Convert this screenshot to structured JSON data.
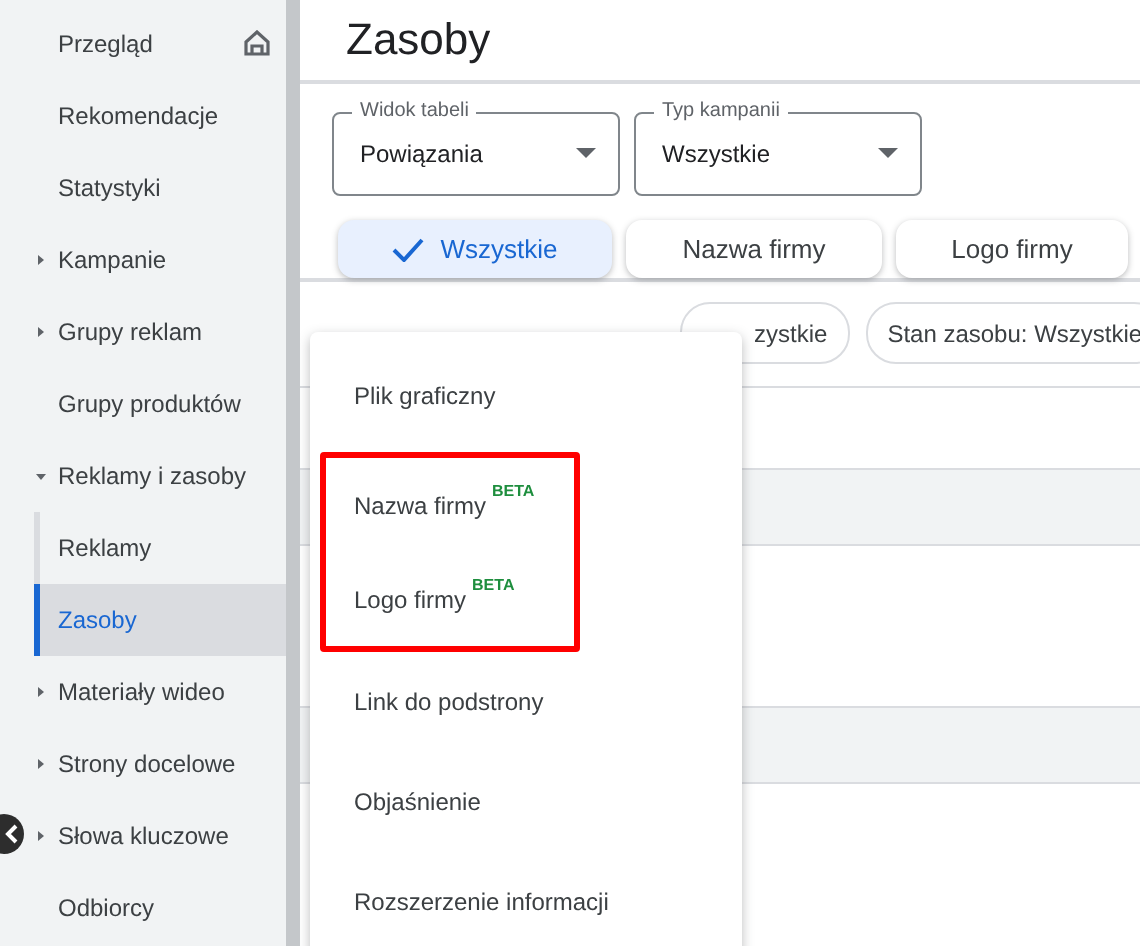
{
  "sidebar": {
    "items": [
      {
        "label": "Przegląd",
        "kind": "home",
        "selected": false
      },
      {
        "label": "Rekomendacje",
        "kind": "plain",
        "selected": false
      },
      {
        "label": "Statystyki",
        "kind": "plain",
        "selected": false
      },
      {
        "label": "Kampanie",
        "kind": "expander",
        "expanded": false,
        "selected": false
      },
      {
        "label": "Grupy reklam",
        "kind": "expander",
        "expanded": false,
        "selected": false
      },
      {
        "label": "Grupy produktów",
        "kind": "plain",
        "selected": false
      },
      {
        "label": "Reklamy i zasoby",
        "kind": "expander",
        "expanded": true,
        "selected": false,
        "children": [
          {
            "label": "Reklamy",
            "selected": false
          },
          {
            "label": "Zasoby",
            "selected": true
          }
        ]
      },
      {
        "label": "Materiały wideo",
        "kind": "expander",
        "expanded": false,
        "selected": false
      },
      {
        "label": "Strony docelowe",
        "kind": "expander",
        "expanded": false,
        "selected": false
      },
      {
        "label": "Słowa kluczowe",
        "kind": "expander",
        "expanded": false,
        "selected": false
      },
      {
        "label": "Odbiorcy",
        "kind": "plain",
        "selected": false
      }
    ]
  },
  "page": {
    "title": "Zasoby"
  },
  "filters": [
    {
      "label": "Widok tabeli",
      "value": "Powiązania"
    },
    {
      "label": "Typ kampanii",
      "value": "Wszystkie"
    }
  ],
  "segments": [
    {
      "label": "Wszystkie",
      "selected": true
    },
    {
      "label": "Nazwa firmy",
      "selected": false
    },
    {
      "label": "Logo firmy",
      "selected": false
    }
  ],
  "filter_chips": [
    "zystkie",
    "Stan zasobu: Wszystkie"
  ],
  "menu": {
    "items": [
      {
        "label": "Plik graficzny",
        "highlighted": false
      },
      {
        "label": "Nazwa firmy",
        "badge": "BETA",
        "highlighted": true
      },
      {
        "label": "Logo firmy",
        "badge": "BETA",
        "highlighted": true
      },
      {
        "label": "Link do podstrony",
        "highlighted": false
      },
      {
        "label": "Objaśnienie",
        "highlighted": false
      },
      {
        "label": "Rozszerzenie informacji",
        "highlighted": false
      }
    ]
  }
}
